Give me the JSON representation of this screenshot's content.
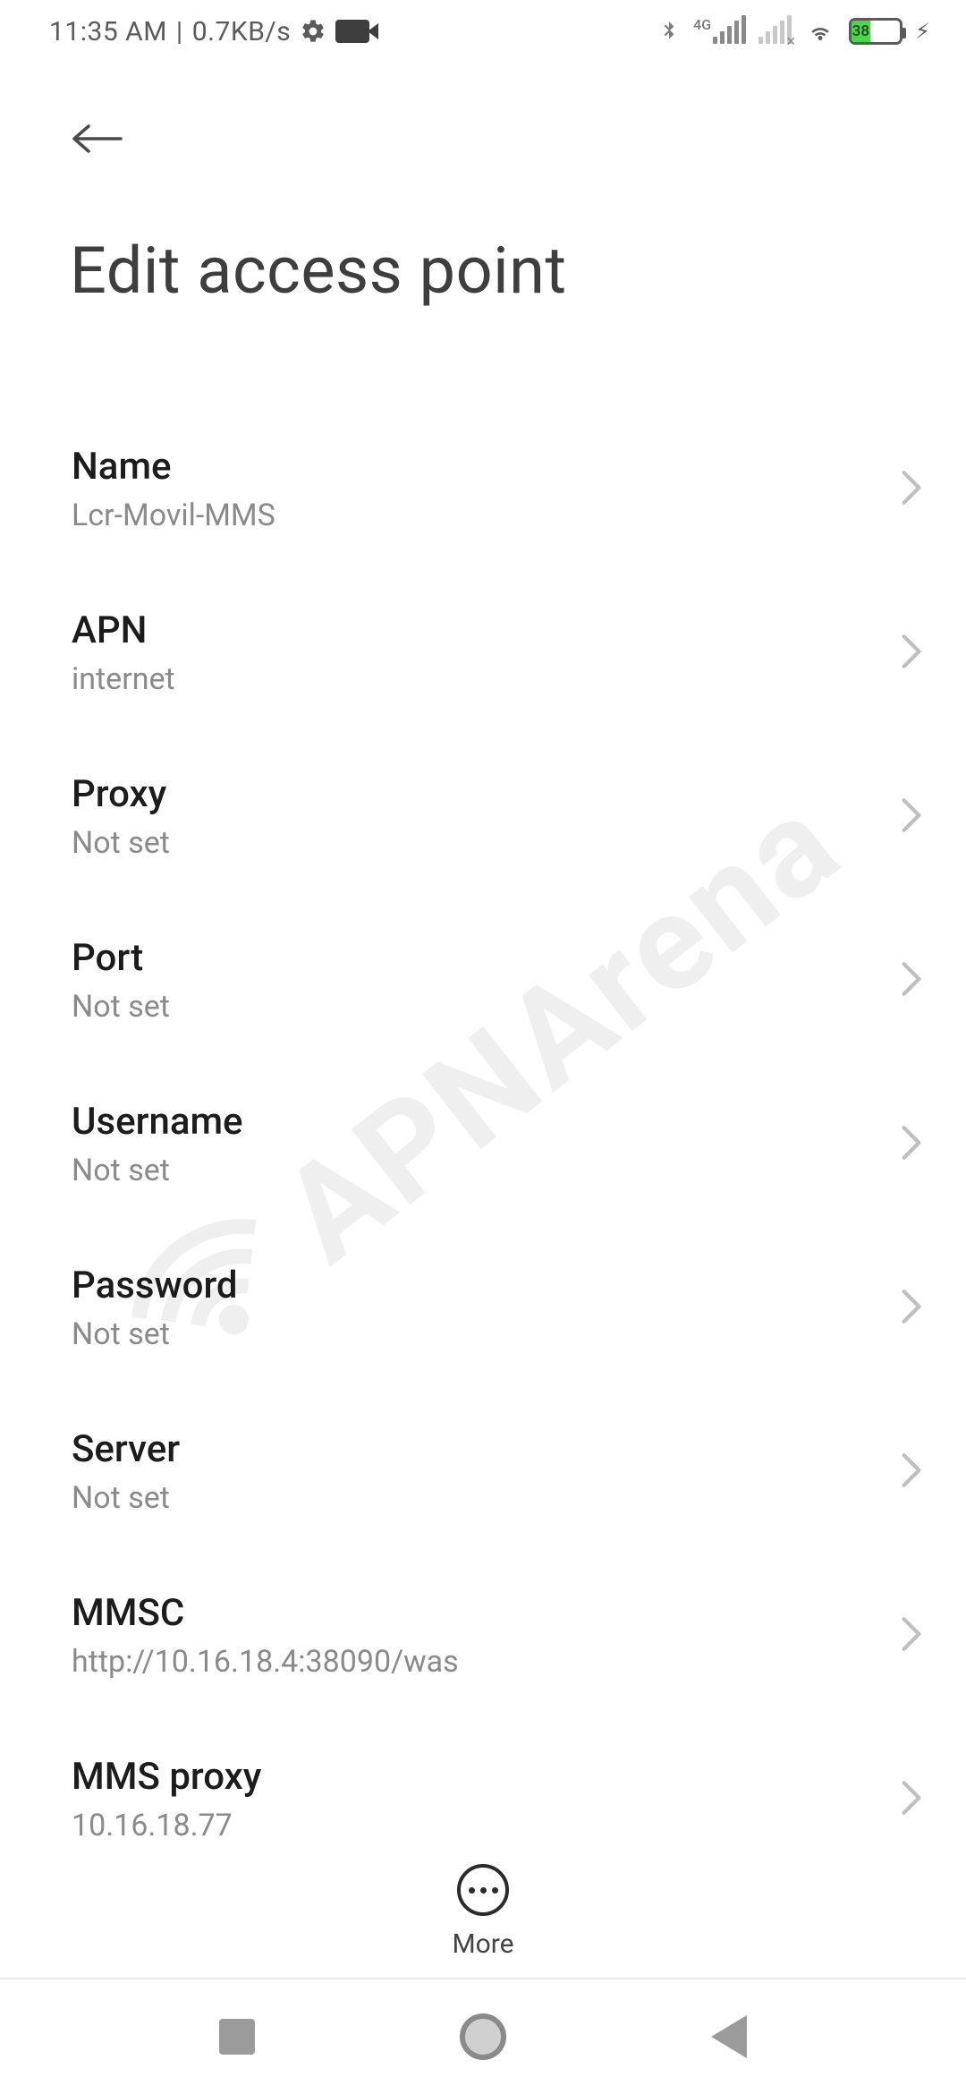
{
  "status": {
    "time": "11:35 AM",
    "speed": "0.7KB/s",
    "network_badge": "4G",
    "battery_pct": "38"
  },
  "header": {
    "title": "Edit access point"
  },
  "rows": {
    "name": {
      "label": "Name",
      "value": "Lcr-Movil-MMS"
    },
    "apn": {
      "label": "APN",
      "value": "internet"
    },
    "proxy": {
      "label": "Proxy",
      "value": "Not set"
    },
    "port": {
      "label": "Port",
      "value": "Not set"
    },
    "username": {
      "label": "Username",
      "value": "Not set"
    },
    "password": {
      "label": "Password",
      "value": "Not set"
    },
    "server": {
      "label": "Server",
      "value": "Not set"
    },
    "mmsc": {
      "label": "MMSC",
      "value": "http://10.16.18.4:38090/was"
    },
    "mmsproxy": {
      "label": "MMS proxy",
      "value": "10.16.18.77"
    }
  },
  "bottom": {
    "more_label": "More"
  },
  "watermark": "APNArena"
}
